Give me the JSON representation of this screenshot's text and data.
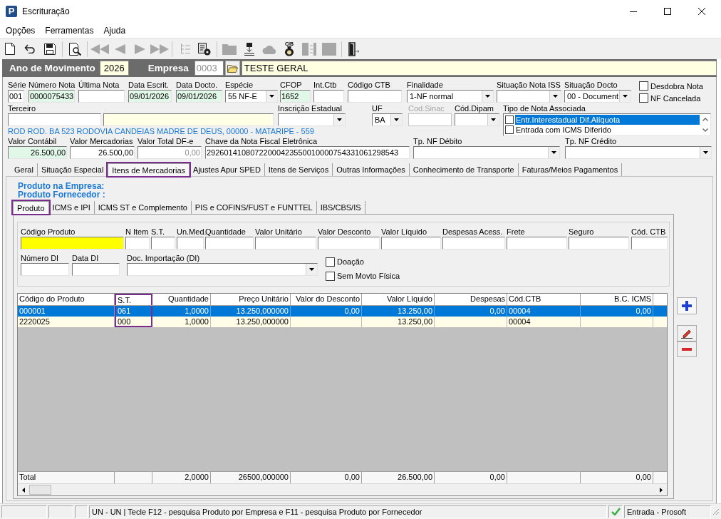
{
  "window": {
    "logo": "P",
    "title": "Escrituração"
  },
  "menu": [
    {
      "label": "Opções"
    },
    {
      "label": "Ferramentas"
    },
    {
      "label": "Ajuda"
    }
  ],
  "toolbar": [
    [
      {
        "disabled": false
      },
      {
        "disabled": false
      },
      {
        "disabled": false
      }
    ],
    [
      {
        "disabled": false
      }
    ],
    [
      {
        "disabled": true
      },
      {
        "disabled": true
      },
      {
        "disabled": true
      },
      {
        "disabled": true
      }
    ],
    [
      {
        "disabled": true
      },
      {
        "disabled": false
      }
    ],
    [
      {
        "disabled": true
      },
      {
        "disabled": false
      },
      {
        "disabled": true
      },
      {
        "disabled": false,
        "caption": "CIB"
      },
      {
        "disabled": true
      },
      {
        "disabled": true
      }
    ],
    [
      {
        "disabled": false
      }
    ]
  ],
  "header_bar": {
    "year_label": "Ano de Movimento",
    "year": "2026",
    "company_label": "Empresa",
    "company_code": {
      "value": "0003",
      "read_only": true
    },
    "company_name": "TESTE GERAL"
  },
  "row_1": [
    {
      "kind": "text",
      "label": "Série",
      "value": "001",
      "disabled": false,
      "read_only": false
    },
    {
      "kind": "text",
      "label": "Número Nota",
      "value": "0000075433",
      "color": "#e1f7e7",
      "disabled": false,
      "read_only": false
    },
    {
      "kind": "text",
      "label": "Última Nota",
      "disabled": false
    },
    {
      "kind": "text",
      "label": "Data Escrit.",
      "value": "09/01/2026",
      "color": "#e1f7e7",
      "disabled": false,
      "read_only": false
    },
    {
      "kind": "text",
      "label": "Data Docto.",
      "value": "09/01/2026",
      "color": "#e1f7e7",
      "disabled": false,
      "read_only": false
    },
    {
      "kind": "select",
      "label": "Espécie",
      "value": "55 NF-E",
      "disabled": false,
      "read_only": false
    },
    {
      "kind": "text",
      "label": "CFOP",
      "value": "1652",
      "color": "#e1f7e7",
      "disabled": false,
      "read_only": false
    },
    {
      "kind": "text",
      "label": "Int.Ctb",
      "disabled": false
    },
    {
      "kind": "text",
      "label": "Código CTB",
      "disabled": false
    },
    {
      "kind": "select",
      "label": "Finalidade",
      "value": "1-NF normal",
      "disabled": false,
      "read_only": false
    },
    {
      "kind": "select",
      "label": "Situação Nota ISS",
      "disabled": false
    },
    {
      "kind": "select",
      "label": "Situação Docto",
      "value": "00 - Document",
      "disabled": false,
      "read_only": false
    }
  ],
  "flags": [
    {
      "label": "Desdobra Nota",
      "checked": false
    },
    {
      "label": "NF Cancelada",
      "checked": false
    }
  ],
  "row_2": [
    {
      "kind": "text",
      "label": "Terceiro",
      "disabled": false
    },
    {
      "kind": "text",
      "color": "#ffffe6",
      "disabled": false
    },
    {
      "kind": "select",
      "label": "Inscrição Estadual",
      "disabled": false
    },
    {
      "kind": "select",
      "label": "UF",
      "value": "BA",
      "disabled": false,
      "read_only": false
    },
    {
      "kind": "text",
      "label": "Cod.Sinac",
      "disabled": true
    },
    {
      "kind": "select",
      "label": "Cód.Dipam",
      "disabled": false
    }
  ],
  "associated_note_types": {
    "label": "Tipo de Nota Associada",
    "items": [
      {
        "label": "Entr.Interestadual Dif.Alíquota",
        "checked": false,
        "selected": true
      },
      {
        "label": "Entrada com ICMS Diferido",
        "checked": false,
        "selected": false
      }
    ]
  },
  "address": "ROD ROD. BA 523 RODOVIA CANDEIAS MADRE DE DEUS, 00000 - MATARIPE - 559",
  "row_3": [
    {
      "kind": "number",
      "label": "Valor Contábil",
      "value": "26.500,00",
      "color": "#e1f7e7",
      "disabled": false,
      "read_only": false
    },
    {
      "kind": "number",
      "label": "Valor Mercadorias",
      "value": "26.500,00",
      "disabled": false,
      "read_only": false
    },
    {
      "kind": "number",
      "label": "Valor Total DF-e",
      "value": "0,00",
      "disabled": false,
      "read_only": true
    },
    {
      "kind": "text",
      "label": "Chave da Nota Fiscal Eletrônica",
      "value": "29260141080722000423550010000754331061298543",
      "disabled": false,
      "read_only": false
    },
    {
      "kind": "select",
      "label": "Tp. NF Débito",
      "disabled": false
    },
    {
      "kind": "select",
      "label": "Tp. NF Crédito",
      "disabled": false
    }
  ],
  "tabs": [
    {
      "label": "Geral",
      "selected": false,
      "highlighted": false
    },
    {
      "label": "Situação Especial",
      "selected": false,
      "highlighted": false
    },
    {
      "label": "Itens de Mercadorias",
      "selected": true,
      "highlighted": true
    },
    {
      "label": "Ajustes Apur SPED",
      "selected": false,
      "highlighted": false
    },
    {
      "label": "Itens de Serviços",
      "selected": false,
      "highlighted": false
    },
    {
      "label": "Outras Informações",
      "selected": false,
      "highlighted": false
    },
    {
      "label": "Conhecimento de Transporte",
      "selected": false,
      "highlighted": false
    },
    {
      "label": "Faturas/Meios Pagamentos",
      "selected": false,
      "highlighted": false
    }
  ],
  "product_lookup": [
    "Produto na Empresa:",
    "Produto Fornecedor :"
  ],
  "inner_tabs": [
    {
      "label": "Produto",
      "selected": true,
      "highlighted": true
    },
    {
      "label": "ICMS e IPI",
      "selected": false,
      "highlighted": false
    },
    {
      "label": "ICMS ST e Complemento",
      "selected": false,
      "highlighted": false
    },
    {
      "label": "PIS e COFINS/FUST e FUNTTEL",
      "selected": false,
      "highlighted": false
    },
    {
      "label": "IBS/CBS/IS",
      "selected": false,
      "highlighted": false
    }
  ],
  "product_form": {
    "row_1": [
      {
        "kind": "text",
        "label": "Código Produto",
        "color": "#ffff00",
        "disabled": false
      },
      {
        "kind": "text",
        "label": "N Item",
        "disabled": false
      },
      {
        "kind": "text",
        "label": "S.T.",
        "disabled": false
      },
      {
        "kind": "text",
        "label": "Un.Med.",
        "disabled": false
      },
      {
        "kind": "text",
        "label": "Quantidade",
        "disabled": false
      },
      {
        "kind": "text",
        "label": "Valor Unitário",
        "disabled": false
      },
      {
        "kind": "text",
        "label": "Valor Desconto",
        "disabled": false
      },
      {
        "kind": "text",
        "label": "Valor Líquido",
        "disabled": false
      },
      {
        "kind": "text",
        "label": "Despesas Acess.",
        "disabled": false
      },
      {
        "kind": "text",
        "label": "Frete",
        "disabled": false
      },
      {
        "kind": "text",
        "label": "Seguro",
        "disabled": false
      },
      {
        "kind": "text",
        "label": "Cód. CTB",
        "disabled": false
      }
    ],
    "row_2": [
      {
        "kind": "text",
        "label": "Número DI",
        "disabled": false
      },
      {
        "kind": "text",
        "label": "Data DI",
        "disabled": false
      },
      {
        "kind": "select",
        "label": "Doc. Importação (DI)",
        "disabled": false
      }
    ],
    "options": [
      {
        "label": "Doação",
        "checked": false
      },
      {
        "label": "Sem Movto Física",
        "checked": false
      }
    ]
  },
  "grid": {
    "columns": [
      {
        "label": "Código do Produto",
        "kind": "text",
        "highlighted": false
      },
      {
        "label": "S.T.",
        "kind": "text",
        "highlighted": true
      },
      {
        "label": "Quantidade",
        "kind": "number",
        "highlighted": false
      },
      {
        "label": "Preço Unitário",
        "kind": "number",
        "highlighted": false
      },
      {
        "label": "Valor do Desconto",
        "kind": "number",
        "highlighted": false
      },
      {
        "label": "Valor Líquido",
        "kind": "number",
        "highlighted": false
      },
      {
        "label": "Despesas",
        "kind": "number",
        "highlighted": false
      },
      {
        "label": "Cód.CTB",
        "kind": "text",
        "highlighted": false
      },
      {
        "label": "B.C. ICMS",
        "kind": "number",
        "highlighted": false
      }
    ],
    "rows": [
      {
        "selected": true,
        "code": "000001",
        "st": "061",
        "quantity": "1,0000",
        "unit_price": "13.250,000000",
        "discount": "0,00",
        "net_value": "13.250,00",
        "expenses": "0,00",
        "ctb_code": "00004",
        "icms_base": "0,00"
      },
      {
        "selected": false,
        "code": "2220025",
        "st": "000",
        "quantity": "1,0000",
        "unit_price": "13.250,000000",
        "net_value": "13.250,00",
        "ctb_code": "00004"
      }
    ],
    "totals": {
      "label": "Total",
      "quantity": "2,0000",
      "unit_price": "26500,000000",
      "discount": "0,00",
      "net_value": "26.500,00",
      "expenses": "0,00",
      "icms_base": "0,00"
    }
  },
  "status_bar": {
    "message": "UN - UN | Tecle F12 - pesquisa Produto por Empresa e F11 - pesquisa Produto por Fornecedor",
    "ok": true,
    "mode": "Entrada - Prosoft"
  }
}
